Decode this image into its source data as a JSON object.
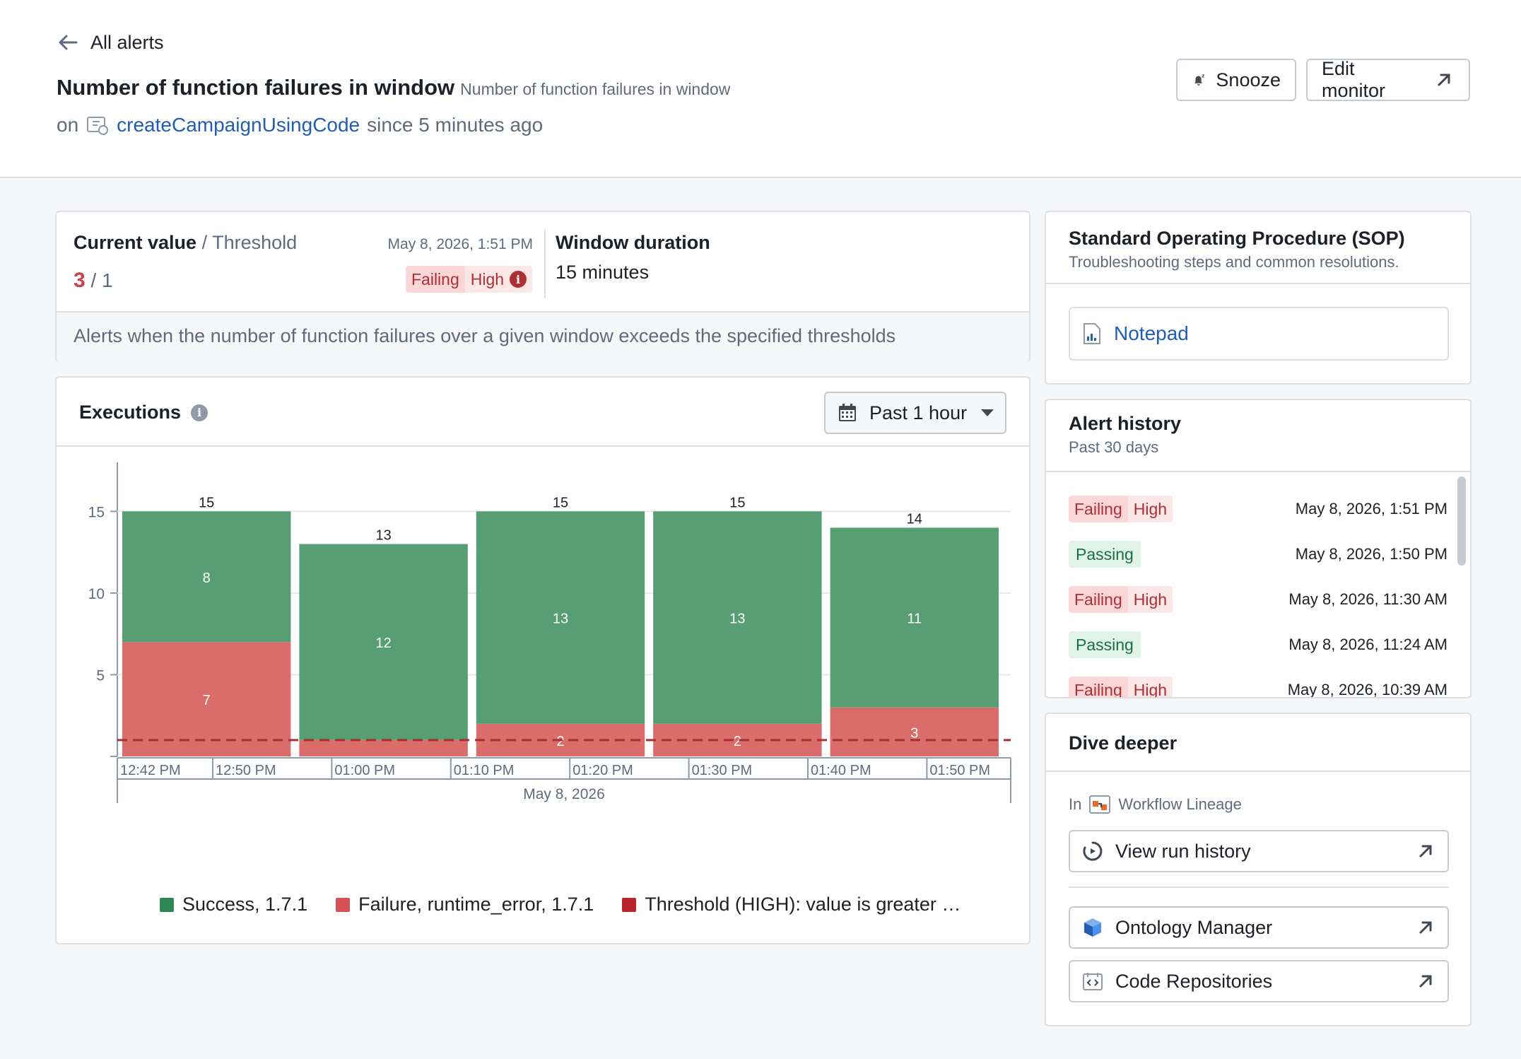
{
  "header": {
    "back_label": "All alerts",
    "title": "Number of function failures in window",
    "subtitle": "Number of function failures in window",
    "on_prefix": "on",
    "function_name": "createCampaignUsingCode",
    "since": "since 5 minutes ago",
    "snooze_label": "Snooze",
    "edit_label": "Edit monitor"
  },
  "current": {
    "label": "Current value",
    "threshold_label": "/ Threshold",
    "value": "3",
    "threshold": "/ 1",
    "timestamp": "May 8, 2026, 1:51 PM",
    "status": "Failing",
    "severity": "High",
    "window_label": "Window duration",
    "window_value": "15 minutes",
    "description": "Alerts when the number of function failures over a given window exceeds the specified thresholds"
  },
  "executions": {
    "title": "Executions",
    "range_label": "Past 1 hour"
  },
  "chart_data": {
    "type": "bar",
    "stacked": true,
    "categories": [
      "12:42 PM – 12:57 PM",
      "12:57 PM – 01:12 PM",
      "01:12 PM – 01:27 PM",
      "01:27 PM – 01:42 PM",
      "01:42 PM – 01:57 PM"
    ],
    "series": [
      {
        "name": "Failure, runtime_error, 1.7.1",
        "color": "#da6c6c",
        "values": [
          7,
          1,
          2,
          2,
          3
        ]
      },
      {
        "name": "Success, 1.7.1",
        "color": "#579e74",
        "values": [
          8,
          12,
          13,
          13,
          11
        ]
      }
    ],
    "totals": [
      15,
      13,
      15,
      15,
      14
    ],
    "segment_labels": {
      "failure": [
        "7",
        "",
        "2",
        "2",
        "3"
      ],
      "success": [
        "8",
        "12",
        "13",
        "13",
        "11"
      ]
    },
    "threshold": {
      "name": "Threshold (HIGH): value is greater …",
      "value": 1,
      "color": "#ac2f33"
    },
    "yticks": [
      5,
      10,
      15
    ],
    "ylim": [
      0,
      18
    ],
    "xticks": [
      "12:42 PM",
      "12:50 PM",
      "01:00 PM",
      "01:10 PM",
      "01:20 PM",
      "01:30 PM",
      "01:40 PM",
      "01:50 PM"
    ],
    "xlabel": "May 8, 2026",
    "legend": [
      "Success, 1.7.1",
      "Failure, runtime_error, 1.7.1",
      "Threshold (HIGH): value is greater …"
    ],
    "legend_position": "bottom",
    "grid": true
  },
  "sop": {
    "title": "Standard Operating Procedure (SOP)",
    "subtitle": "Troubleshooting steps and common resolutions.",
    "notepad_label": "Notepad"
  },
  "history": {
    "title": "Alert history",
    "subtitle": "Past 30 days",
    "items": [
      {
        "status": "Failing",
        "severity": "High",
        "date": "May 8, 2026, 1:51 PM"
      },
      {
        "status": "Passing",
        "severity": "",
        "date": "May 8, 2026, 1:50 PM"
      },
      {
        "status": "Failing",
        "severity": "High",
        "date": "May 8, 2026, 11:30 AM"
      },
      {
        "status": "Passing",
        "severity": "",
        "date": "May 8, 2026, 11:24 AM"
      },
      {
        "status": "Failing",
        "severity": "High",
        "date": "May 8, 2026, 10:39 AM"
      }
    ]
  },
  "dive": {
    "title": "Dive deeper",
    "in_prefix": "In",
    "in_app": "Workflow Lineage",
    "run_history": "View run history",
    "ontology": "Ontology Manager",
    "code_repos": "Code Repositories"
  },
  "colors": {
    "link": "#215db0",
    "failing": "#ac2f33",
    "passing": "#1c6e42",
    "success_bar": "#579e74",
    "failure_bar": "#da6c6c"
  }
}
